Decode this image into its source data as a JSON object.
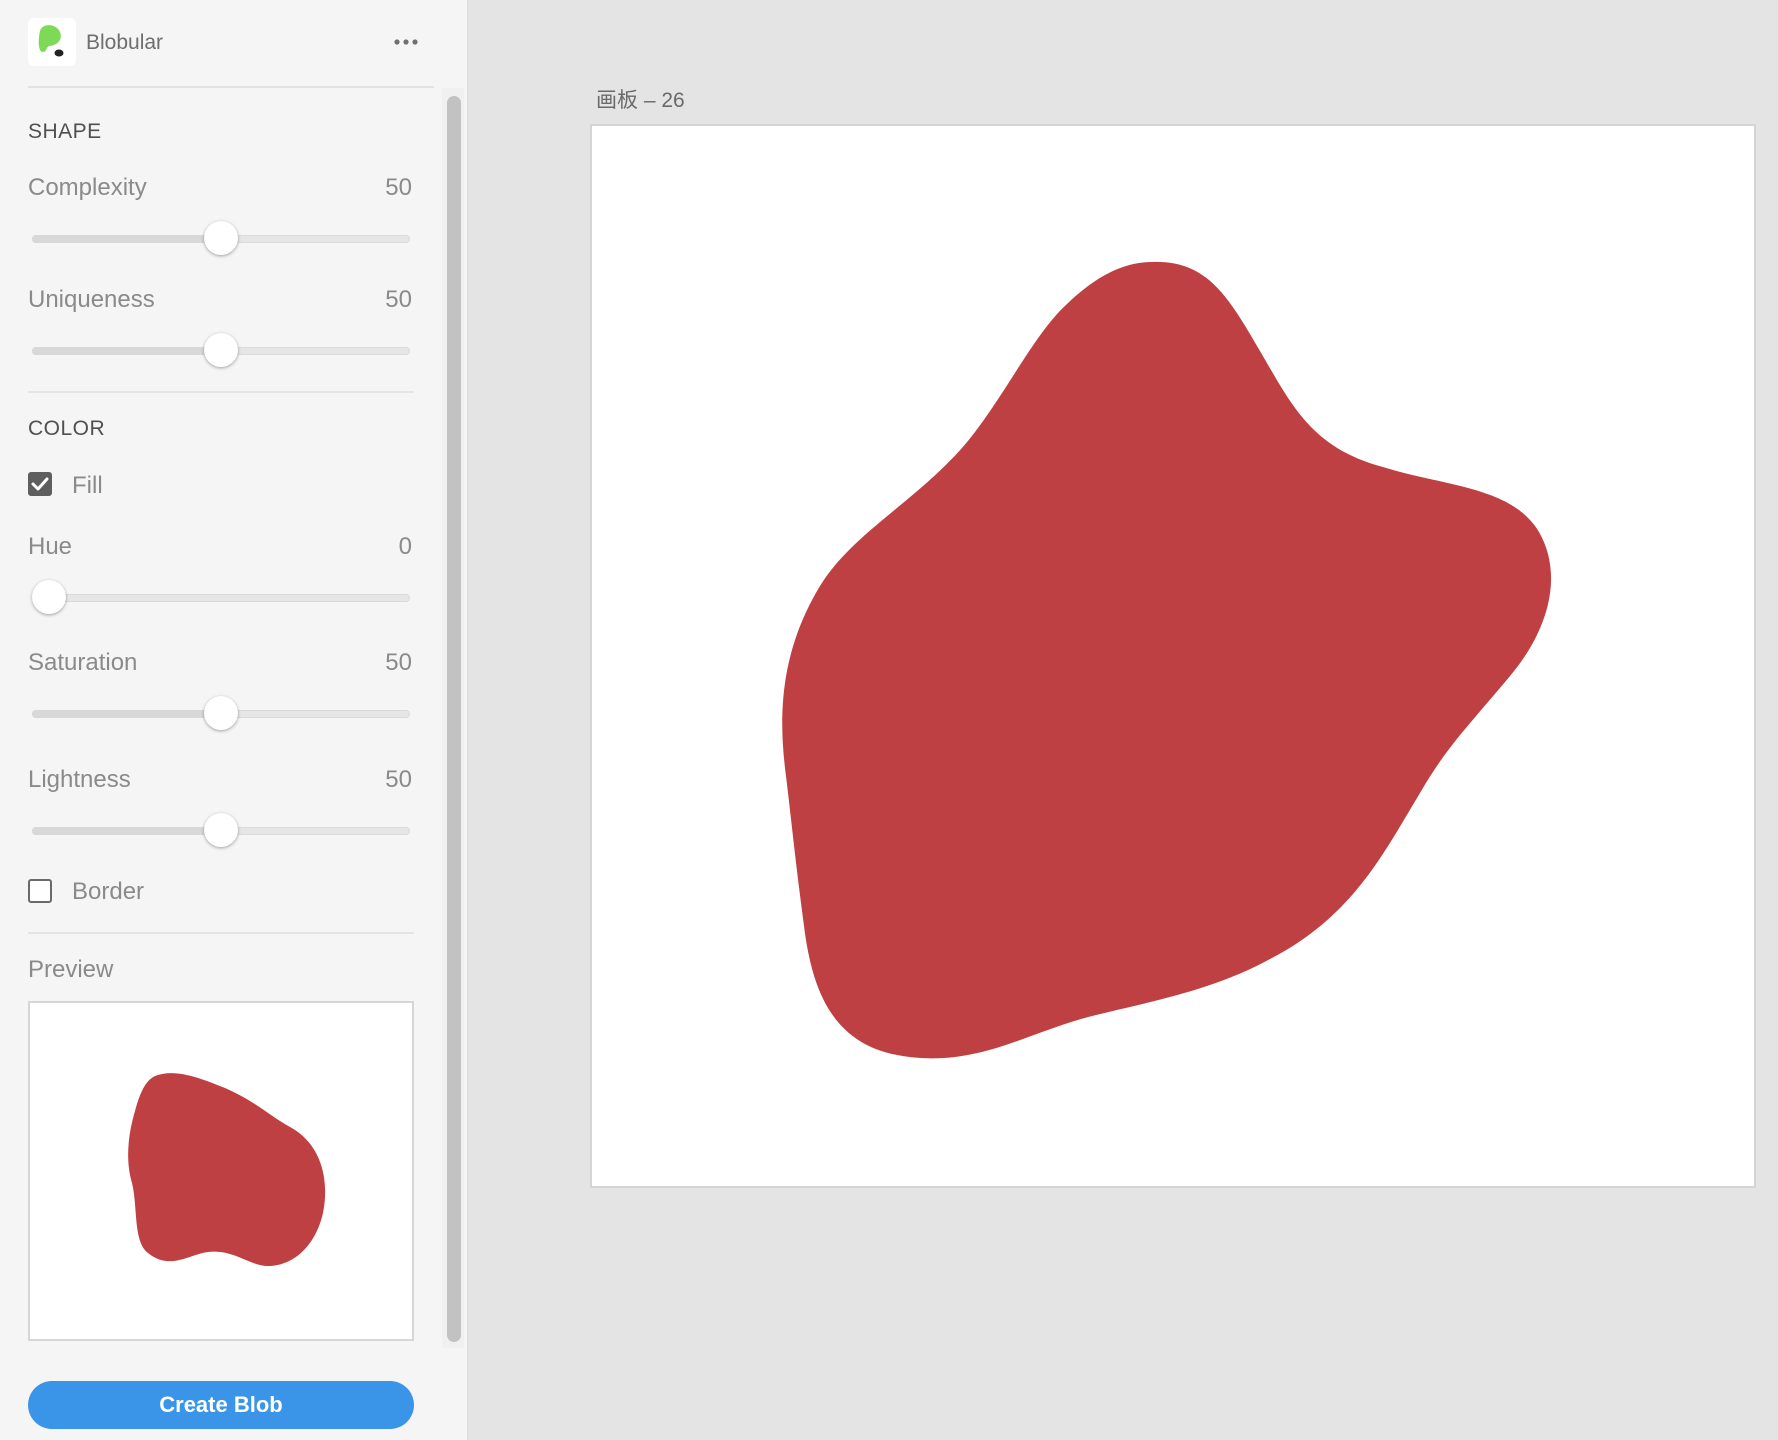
{
  "plugin": {
    "name": "Blobular",
    "icon": "blobular-logo-icon",
    "menu_icon": "more-dots-icon"
  },
  "shape": {
    "title": "SHAPE",
    "complexity": {
      "label": "Complexity",
      "value": "50",
      "level": 0.5
    },
    "uniqueness": {
      "label": "Uniqueness",
      "value": "50",
      "level": 0.5
    }
  },
  "color": {
    "title": "COLOR",
    "fill": {
      "label": "Fill",
      "checked": true
    },
    "hue": {
      "label": "Hue",
      "value": "0",
      "level": 0.0
    },
    "saturation": {
      "label": "Saturation",
      "value": "50",
      "level": 0.5
    },
    "lightness": {
      "label": "Lightness",
      "value": "50",
      "level": 0.5
    },
    "border": {
      "label": "Border",
      "checked": false
    }
  },
  "preview": {
    "title": "Preview"
  },
  "actions": {
    "create_label": "Create Blob"
  },
  "canvas": {
    "artboard_label": "画板 – 26"
  },
  "colors": {
    "blob": "#bf4042",
    "button": "#3a94e8",
    "logo_green": "#7ed957"
  }
}
